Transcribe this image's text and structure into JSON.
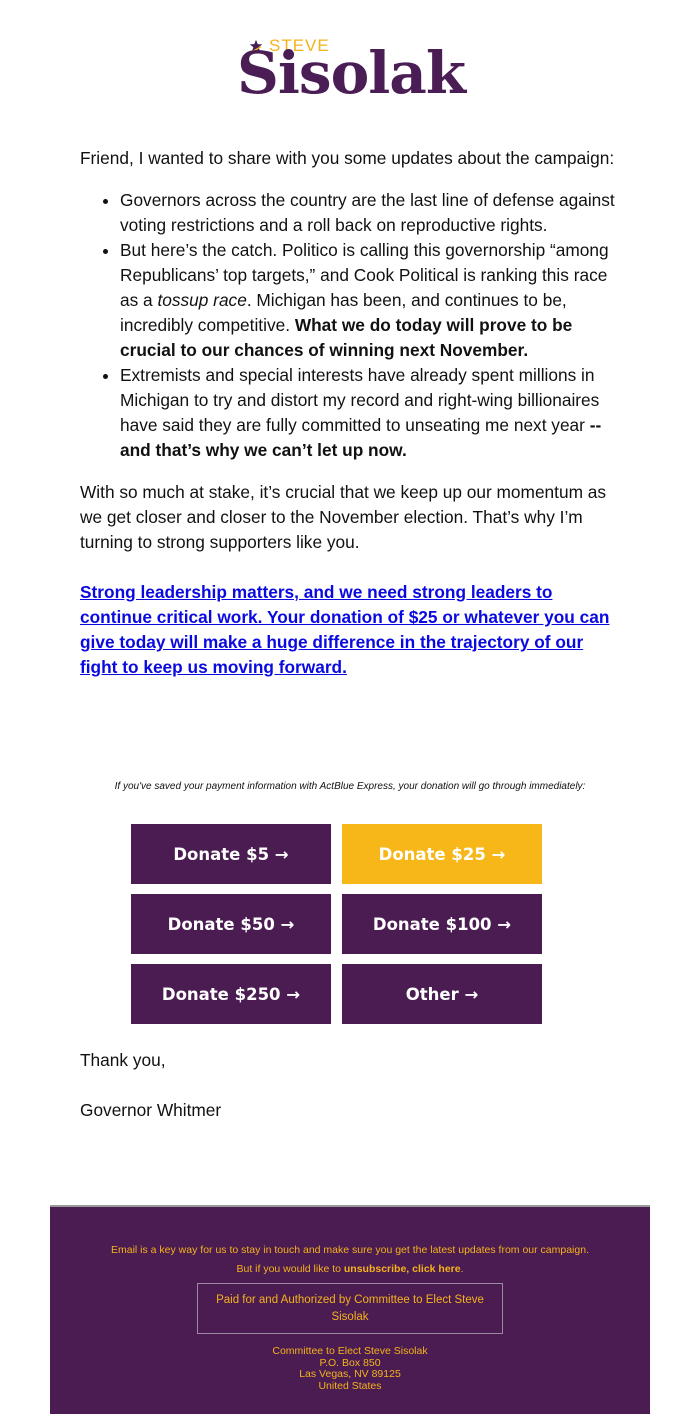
{
  "header": {
    "logo_small": "STEVE",
    "logo_name": "Sisolak",
    "logo_icon": "star-icon"
  },
  "body": {
    "intro": "Friend, I wanted to share with you some updates about the campaign:",
    "bullets": [
      {
        "text": "Governors across the country are the last line of defense against voting restrictions and a roll back on reproductive rights."
      },
      {
        "text_a": "But here’s the catch. Politico is calling this governorship “among Republicans’ top targets,” and Cook Political is ranking this race as a ",
        "italic": "tossup race",
        "text_b": ". Michigan has been, and continues to be, incredibly competitive. ",
        "bold": "What we do today will prove to be crucial to our chances of winning next November."
      },
      {
        "text_a": "Extremists and special interests have already spent millions in Michigan to try and distort my record and right-wing billionaires have said they are fully committed to unseating me next year ",
        "bold": "-- and that’s why we can’t let up now."
      }
    ],
    "para2": "With so much at stake, it’s crucial that we keep up our momentum as we get closer and closer to the November election. That’s why I’m turning to strong supporters like you.",
    "cta_link": "Strong leadership matters, and we need strong leaders to continue critical work. Your donation of $25 or whatever you can give today will make a huge difference in the trajectory of our fight to keep us moving forward.",
    "express_note": "If you've saved your payment information with ActBlue Express, your donation will go through immediately:"
  },
  "donate_buttons": [
    {
      "label": "Donate $5 →"
    },
    {
      "label": "Donate $25 →"
    },
    {
      "label": "Donate $50 →"
    },
    {
      "label": "Donate $100 →"
    },
    {
      "label": "Donate $250 →"
    },
    {
      "label": "Other →"
    }
  ],
  "signoff": {
    "thanks": "Thank you,",
    "signature": "Governor Whitmer"
  },
  "footer": {
    "line1": "Email is a key way for us to stay in touch and make sure you get the latest updates from our campaign.",
    "line2_prefix": "But if you would like to ",
    "unsubscribe_link": "unsubscribe, click here",
    "line2_suffix": ".",
    "paid_for": "Paid for and Authorized by Committee to Elect Steve Sisolak",
    "address": [
      "Committee to Elect Steve Sisolak",
      "P.O. Box 850",
      "Las Vegas, NV 89125",
      "United States"
    ]
  },
  "colors": {
    "brand_purple": "#4a1c52",
    "brand_yellow": "#f7b718",
    "link_blue": "#0a0ae0"
  }
}
